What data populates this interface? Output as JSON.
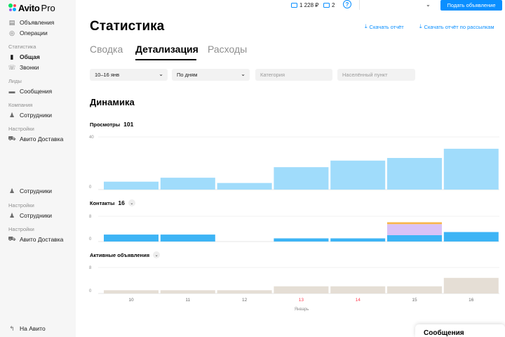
{
  "app": {
    "logo_text": "Avito",
    "logo_pro": "Pro"
  },
  "sidebar": {
    "items": [
      {
        "label": "Объявления",
        "icon": "list-icon",
        "active": false
      },
      {
        "label": "Операции",
        "icon": "operations-icon",
        "active": false
      },
      {
        "section": "Статистика"
      },
      {
        "label": "Общая",
        "icon": "bar-chart-icon",
        "active": true
      },
      {
        "label": "Звонки",
        "icon": "phone-icon",
        "active": false
      },
      {
        "section": "Лиды"
      },
      {
        "label": "Сообщения",
        "icon": "chat-icon",
        "active": false
      },
      {
        "section": "Компания"
      },
      {
        "label": "Сотрудники",
        "icon": "users-icon",
        "active": false
      },
      {
        "section": "Настройки"
      },
      {
        "label": "Авито Доставка",
        "icon": "truck-icon",
        "active": false
      },
      {
        "label": "Сотрудники",
        "icon": "users-icon",
        "active": false
      },
      {
        "section": "Настройки"
      },
      {
        "label": "Сотрудники",
        "icon": "users-icon",
        "active": false
      },
      {
        "section": "Настройки"
      },
      {
        "label": "Авито Доставка",
        "icon": "truck-icon",
        "active": false
      }
    ],
    "bottom_link": "На Авито"
  },
  "topbar": {
    "wallet": "1 228 ₽",
    "messages_count": "2",
    "help": "?",
    "post_button": "Подать объявление"
  },
  "header": {
    "title": "Статистика",
    "download": "Скачать отчёт",
    "download_mailing": "Скачать отчёт по рассылкам"
  },
  "tabs": [
    {
      "label": "Сводка",
      "active": false
    },
    {
      "label": "Детализация",
      "active": true
    },
    {
      "label": "Расходы",
      "active": false
    }
  ],
  "filters": {
    "period": "10–16 янв",
    "grouping": "По дням",
    "category_placeholder": "Категория",
    "city_placeholder": "Населённый пункт"
  },
  "section_title": "Динамика",
  "colors": {
    "views": "#a0dcfb",
    "contacts_blue": "#3db4f5",
    "contacts_lilac": "#d9c2f7",
    "contacts_orange": "#f8b54a",
    "active_ads": "#e5ded5",
    "weekend": "#ff4053",
    "accent": "#0a8fff"
  },
  "chart_data": [
    {
      "type": "bar",
      "title": "Просмотры",
      "total": "101",
      "categories": [
        "10",
        "11",
        "12",
        "13",
        "14",
        "15",
        "16"
      ],
      "series": [
        {
          "values": [
            6,
            9,
            5,
            17,
            22,
            24,
            31
          ]
        }
      ],
      "ylim": [
        0,
        40
      ],
      "yticks": [
        "40",
        "0"
      ]
    },
    {
      "type": "bar",
      "title": "Контакты",
      "total": "16",
      "categories": [
        "10",
        "11",
        "12",
        "13",
        "14",
        "15",
        "16"
      ],
      "stacked": true,
      "series": [
        {
          "values": [
            2.2,
            2.2,
            0,
            1,
            1,
            2,
            3
          ]
        },
        {
          "values": [
            0,
            0,
            0,
            0,
            0,
            3.5,
            0
          ]
        },
        {
          "values": [
            0,
            0,
            0,
            0,
            0,
            0.6,
            0
          ]
        }
      ],
      "ylim": [
        0,
        8
      ],
      "yticks": [
        "8",
        "0"
      ]
    },
    {
      "type": "bar",
      "title": "Активные объявления",
      "categories": [
        "10",
        "11",
        "12",
        "13",
        "14",
        "15",
        "16"
      ],
      "series": [
        {
          "values": [
            1,
            1,
            1,
            2.2,
            2.2,
            2.2,
            4.8
          ]
        }
      ],
      "ylim": [
        0,
        8
      ],
      "yticks": [
        "8",
        "0"
      ],
      "xlabel": "Январь",
      "weekend_categories": [
        "13",
        "14"
      ]
    }
  ],
  "messages_panel": "Сообщения"
}
